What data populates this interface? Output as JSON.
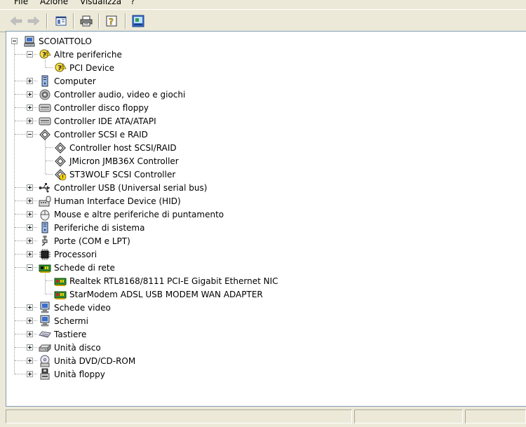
{
  "menu": {
    "file": "File",
    "action": "Azione",
    "view": "Visualizza",
    "help": "?"
  },
  "toolbar": {
    "back_icon": "back-arrow-icon",
    "forward_icon": "forward-arrow-icon",
    "console_tree_icon": "show-hide-console-tree-icon",
    "print_icon": "printer-icon",
    "help_icon": "help-icon",
    "properties_icon": "properties-icon"
  },
  "tree": {
    "root": "SCOIATTOLO",
    "nodes": [
      {
        "label": "Altre periferiche",
        "icon": "warning-device-icon",
        "expanded": true
      },
      {
        "label": "PCI Device",
        "icon": "warning-device-icon",
        "child": true
      },
      {
        "label": "Computer",
        "icon": "computer-icon"
      },
      {
        "label": "Controller audio, video e giochi",
        "icon": "audio-icon"
      },
      {
        "label": "Controller disco floppy",
        "icon": "floppy-controller-icon"
      },
      {
        "label": "Controller IDE ATA/ATAPI",
        "icon": "ide-controller-icon"
      },
      {
        "label": "Controller SCSI e RAID",
        "icon": "scsi-icon",
        "expanded": true
      },
      {
        "label": "Controller host SCSI/RAID",
        "icon": "scsi-icon",
        "child": true
      },
      {
        "label": "JMicron JMB36X Controller",
        "icon": "scsi-icon",
        "child": true
      },
      {
        "label": "ST3WOLF SCSI Controller",
        "icon": "scsi-warning-icon",
        "child": true
      },
      {
        "label": "Controller USB (Universal serial bus)",
        "icon": "usb-icon"
      },
      {
        "label": "Human Interface Device (HID)",
        "icon": "hid-icon"
      },
      {
        "label": "Mouse e altre periferiche di puntamento",
        "icon": "mouse-icon"
      },
      {
        "label": "Periferiche di sistema",
        "icon": "system-device-icon"
      },
      {
        "label": "Porte (COM e LPT)",
        "icon": "port-icon"
      },
      {
        "label": "Processori",
        "icon": "processor-icon"
      },
      {
        "label": "Schede di rete",
        "icon": "network-card-icon",
        "expanded": true
      },
      {
        "label": "Realtek RTL8168/8111 PCI-E Gigabit Ethernet NIC",
        "icon": "network-card-red-icon",
        "child": true
      },
      {
        "label": "StarModem ADSL USB MODEM WAN ADAPTER",
        "icon": "network-card-red-icon",
        "child": true
      },
      {
        "label": "Schede video",
        "icon": "display-adapter-icon"
      },
      {
        "label": "Schermi",
        "icon": "monitor-icon"
      },
      {
        "label": "Tastiere",
        "icon": "keyboard-icon"
      },
      {
        "label": "Unità disco",
        "icon": "disk-drive-icon"
      },
      {
        "label": "Unità DVD/CD-ROM",
        "icon": "dvd-icon"
      },
      {
        "label": "Unità floppy",
        "icon": "floppy-drive-icon"
      }
    ]
  }
}
